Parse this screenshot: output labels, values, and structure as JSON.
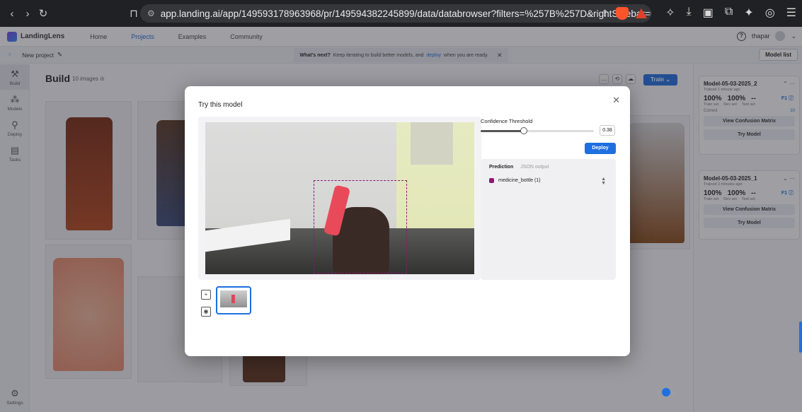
{
  "browser": {
    "url": "app.landing.ai/app/149593178963968/pr/149594382245899/data/databrowser?filters=%257B%257D&rightSidebar=model_..."
  },
  "app": {
    "brand": "LandingLens",
    "nav": [
      "Home",
      "Projects",
      "Examples",
      "Community"
    ],
    "user": "thapar",
    "project_name": "New project",
    "banner": {
      "bold": "What's next?",
      "text": "Keep iterating to build better models, and",
      "link": "deploy",
      "tail": "when you are ready."
    },
    "model_list_label": "Model list"
  },
  "sidebar": [
    {
      "label": "Build",
      "icon": "build-icon"
    },
    {
      "label": "Models",
      "icon": "models-icon"
    },
    {
      "label": "Deploy",
      "icon": "deploy-icon"
    },
    {
      "label": "Tasks",
      "icon": "tasks-icon"
    }
  ],
  "settings_label": "Settings",
  "build": {
    "title": "Build",
    "count": "10 images",
    "train_label": "Train"
  },
  "models": [
    {
      "name": "Model-05-03-2025_2",
      "trained": "Trained 1 minute ago",
      "train": "100%",
      "dev": "100%",
      "test": "--",
      "labels": [
        "Train set",
        "Dev set",
        "Test set"
      ],
      "f1": "F1",
      "correct_label": "Correct",
      "correct_value": "10",
      "btn1": "View Confusion Matrix",
      "btn2": "Try Model"
    },
    {
      "name": "Model-05-03-2025_1",
      "trained": "Trained 2 minutes ago",
      "train": "100%",
      "dev": "100%",
      "test": "--",
      "labels": [
        "Train set",
        "Dev set",
        "Test set"
      ],
      "f1": "F1",
      "btn1": "View Confusion Matrix",
      "btn2": "Try Model"
    }
  ],
  "modal": {
    "title": "Try this model",
    "confidence_label": "Confidence Threshold",
    "confidence_value": "0.38",
    "confidence_fraction": 0.38,
    "deploy_label": "Deploy",
    "tabs": [
      "Prediction",
      "JSON output"
    ],
    "prediction": "medicine_bottle (1)",
    "prediction_color": "#8a1a6e"
  },
  "colors": {
    "accent": "#1f6fe0",
    "bbox": "#8a1a6e"
  }
}
